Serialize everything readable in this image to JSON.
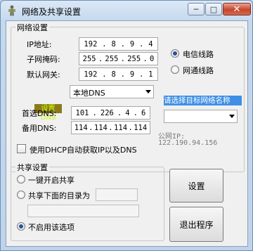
{
  "window": {
    "title": "网络及共享设置",
    "min_glyph": "─",
    "max_glyph": "□",
    "close_glyph": "✕"
  },
  "network": {
    "group_label": "网络设置",
    "ip_label": "IP地址:",
    "mask_label": "子网掩码:",
    "gateway_label": "默认网关:",
    "ip": [
      "192",
      "8",
      "9",
      "4"
    ],
    "mask": [
      "255",
      "255",
      "255",
      "0"
    ],
    "gateway": [
      "192",
      "8",
      "9",
      "1"
    ],
    "line_telecom": "电信线路",
    "line_unicom": "网通线路",
    "line_selected": "telecom",
    "dns_tag": "设置DNS",
    "dns_select_value": "本地DNS",
    "target_hint": "请选择目标网络名称",
    "target_select_value": "",
    "primary_dns_label": "首选DNS:",
    "secondary_dns_label": "备用DNS:",
    "primary_dns": [
      "101",
      "226",
      "4",
      "6"
    ],
    "secondary_dns": [
      "114",
      "114",
      "114",
      "114"
    ],
    "public_ip_label": "公网IP:",
    "public_ip": "122.190.94.156",
    "dhcp_label": "使用DHCP自动获取IP以及DNS",
    "dhcp_checked": false
  },
  "share": {
    "group_label": "共享设置",
    "opt_one_click": "一键开启共享",
    "opt_share_dir": "共享下面的目录为",
    "opt_disable": "不启用该选项",
    "selected": "disable",
    "share_name_value": "",
    "dir_path_value": ""
  },
  "buttons": {
    "setup": "设置",
    "exit": "退出程序"
  },
  "colors": {
    "hint_bg": "#3f8fe6",
    "dns_tag_bg": "#8b7a1c",
    "dns_tag_fg": "#c8ff00",
    "close_btn": "#c7452c"
  }
}
